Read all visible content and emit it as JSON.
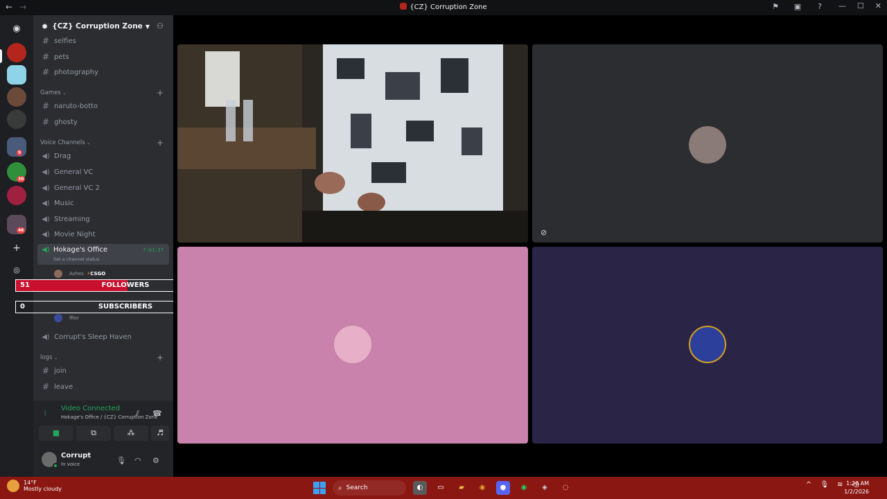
{
  "window": {
    "title": "{CZ} Corruption Zone",
    "back": "←",
    "forward": "→"
  },
  "rail": {
    "badges": [
      "9",
      "30",
      "46"
    ]
  },
  "server": {
    "name": "{CZ} Corruption Zone"
  },
  "channels": {
    "top": [
      "selfies",
      "pets",
      "photography"
    ],
    "games_category": "Games",
    "games": [
      "naruto-botto",
      "ghosty"
    ],
    "voice_category": "Voice Channels",
    "voice": [
      "Drag",
      "General VC",
      "General VC 2",
      "Music",
      "Streaming",
      "Movie Night"
    ],
    "active_voice": {
      "name": "Hokage's Office",
      "status": "Set a channel status",
      "timer": "7:01:37"
    },
    "members": [
      "Ashes",
      "CSGO",
      "ffier"
    ],
    "after_voice": "Corrupt's Sleep Haven",
    "logs_category": "logs",
    "logs": [
      "join",
      "leave"
    ]
  },
  "overlay": {
    "followers": {
      "current": "51",
      "label": "FOLLOWERS",
      "goal": "100",
      "progress": 0.51,
      "color": "#c8102e"
    },
    "subscribers": {
      "current": "0",
      "label": "SUBSCRIBERS",
      "goal": "50",
      "progress": 0.0,
      "color": "#c8102e"
    }
  },
  "voice_panel": {
    "status": "Video Connected",
    "location": "Hokage's Office / {CZ} Corruption Zone"
  },
  "user": {
    "name": "Corrupt",
    "status": "In voice"
  },
  "taskbar": {
    "temp": "14°F",
    "condition": "Mostly cloudy",
    "search": "Search",
    "time": "1:36 AM",
    "date": "1/2/2026"
  },
  "colors": {
    "accent_green": "#23a55a",
    "sidebar_bg": "#2b2d31",
    "rail_bg": "#1e1f22",
    "taskbar_bg": "#8a1712",
    "tile_pink": "#c882ab",
    "tile_navy": "#2a2447"
  }
}
